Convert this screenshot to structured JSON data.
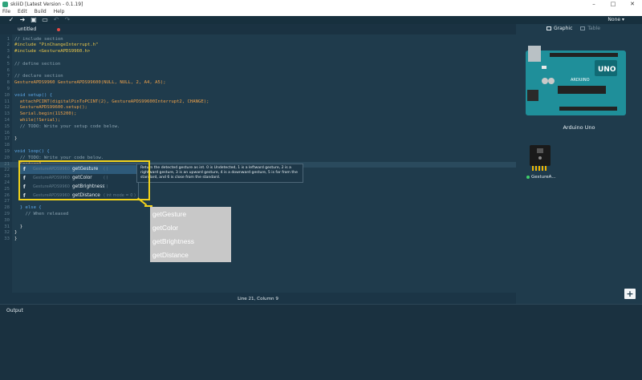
{
  "window": {
    "title": "skiiiD [Latest Version - 0.1.19]",
    "controls": [
      "–",
      "□",
      "✕"
    ]
  },
  "menu": [
    "File",
    "Edit",
    "Build",
    "Help"
  ],
  "toolbar": {
    "icons": [
      "check-icon",
      "arrow-right-icon",
      "save-icon",
      "folder-icon",
      "undo-icon",
      "redo-icon"
    ],
    "glyphs": [
      "✓",
      "➜",
      "▣",
      "▭",
      "↶",
      "↷"
    ],
    "device_select": "None ▾"
  },
  "tab": {
    "name": "untitled"
  },
  "code": [
    {
      "n": "1",
      "text": "// include section",
      "cls": "c-comment"
    },
    {
      "n": "2",
      "text": "#include \"PinChangeInterrupt.h\"",
      "cls": "c-pre"
    },
    {
      "n": "3",
      "text": "#include <GestureAPDS9960.h>",
      "cls": "c-pre"
    },
    {
      "n": "4",
      "text": "",
      "cls": "c-plain"
    },
    {
      "n": "5",
      "text": "// define section",
      "cls": "c-comment"
    },
    {
      "n": "6",
      "text": "",
      "cls": "c-plain"
    },
    {
      "n": "7",
      "text": "// declare section",
      "cls": "c-comment"
    },
    {
      "n": "8",
      "text": "GestureAPDS9960 GestureAPDS99600(NULL, NULL, 2, A4, A5);",
      "cls": "c-fn"
    },
    {
      "n": "9",
      "text": "",
      "cls": "c-plain"
    },
    {
      "n": "10",
      "text": "void setup() {",
      "cls": "c-kw"
    },
    {
      "n": "11",
      "text": "  attachPCINT(digitalPinToPCINT(2), GestureAPDS99600Interrupt2, CHANGE);",
      "cls": "c-fn"
    },
    {
      "n": "12",
      "text": "  GestureAPDS99600.setup();",
      "cls": "c-fn"
    },
    {
      "n": "13",
      "text": "  Serial.begin(115200);",
      "cls": "c-fn"
    },
    {
      "n": "14",
      "text": "  while(!Serial);",
      "cls": "c-fn"
    },
    {
      "n": "15",
      "text": "  // TODO: Write your setup code below.",
      "cls": "c-comment"
    },
    {
      "n": "16",
      "text": "",
      "cls": "c-plain"
    },
    {
      "n": "17",
      "text": "}",
      "cls": "c-plain"
    },
    {
      "n": "18",
      "text": "",
      "cls": "c-plain"
    },
    {
      "n": "19",
      "text": "void loop() {",
      "cls": "c-kw"
    },
    {
      "n": "20",
      "text": "  // TODO: Write your code below.",
      "cls": "c-comment"
    },
    {
      "n": "21",
      "text": "  GestureA",
      "cls": "c-fn"
    },
    {
      "n": "22",
      "text": "",
      "cls": "c-plain"
    },
    {
      "n": "23",
      "text": "",
      "cls": "c-plain"
    },
    {
      "n": "24",
      "text": "  ",
      "cls": "c-plain"
    },
    {
      "n": "25",
      "text": "",
      "cls": "c-plain"
    },
    {
      "n": "26",
      "text": "",
      "cls": "c-plain"
    },
    {
      "n": "27",
      "text": "",
      "cls": "c-plain"
    },
    {
      "n": "28",
      "text": "  } else {",
      "cls": "c-kw"
    },
    {
      "n": "29",
      "text": "    // When released",
      "cls": "c-comment"
    },
    {
      "n": "30",
      "text": "",
      "cls": "c-plain"
    },
    {
      "n": "31",
      "text": "  }",
      "cls": "c-plain"
    },
    {
      "n": "32",
      "text": "}",
      "cls": "c-plain"
    },
    {
      "n": "33",
      "text": "}",
      "cls": "c-plain"
    }
  ],
  "autocomplete": {
    "items": [
      {
        "kind": "f",
        "type": "GestureAPDS9960",
        "name": "getGesture",
        "ret": "( )"
      },
      {
        "kind": "f",
        "type": "GestureAPDS9960",
        "name": "getColor",
        "ret": "( )"
      },
      {
        "kind": "f",
        "type": "GestureAPDS9960",
        "name": "getBrightness",
        "ret": "( )"
      },
      {
        "kind": "f",
        "type": "GestureAPDS9960",
        "name": "getDistance",
        "ret": "( int mode = 0 )"
      }
    ],
    "doc": "Return the detected gesture as int. 0 is Undetected, 1 is a leftward gesture, 2 is a rightward gesture, 3 is an upward gesture, 4 is a downward gesture, 5 is far from the standard, and 6 is close from the standard."
  },
  "callout": [
    "getGesture",
    "getColor",
    "getBrightness",
    "getDistance"
  ],
  "status": "Line 21, Column 9",
  "output_label": "Output",
  "panel": {
    "tabs": [
      "Graphic",
      "Table"
    ],
    "board_name": "Arduino Uno",
    "board_brand": "UNO",
    "board_text": "ARDUINO",
    "sensor_name": "GestureA..."
  },
  "add_button": "+",
  "colors": {
    "accent": "#f1d21b",
    "board": "#1f8f9a",
    "background": "#1f3b4c"
  }
}
